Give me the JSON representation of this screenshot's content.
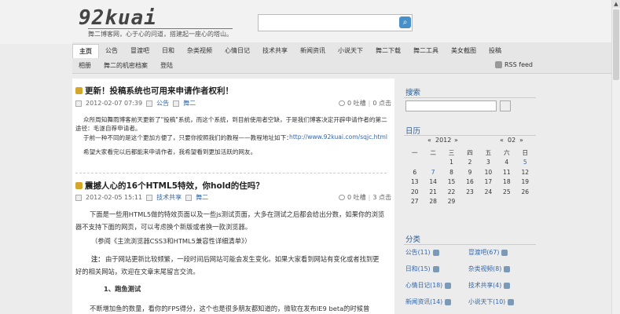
{
  "header": {
    "logo": "92kuai",
    "tagline": "舞二博客网，心于心的问道，搭建起一座心的塔山。",
    "search_placeholder": ""
  },
  "nav": {
    "row1": [
      "主页",
      "公告",
      "冒渡吧",
      "日和",
      "杂类视频",
      "心情日记",
      "技术共享",
      "新闻资讯",
      "小说天下",
      "舞二下载",
      "舞二工具",
      "美女截图",
      "投稿"
    ],
    "row2": [
      "相册",
      "舞二的机密档案",
      "登陆"
    ],
    "rss": "RSS feed"
  },
  "posts": [
    {
      "title": "更新！投稿系统也可用来申请作者权利！",
      "date": "2012-02-07 07:39",
      "category": "公告",
      "author": "舞二",
      "comments": "0 吐槽",
      "views": "0 点击",
      "lines": [
        "众所周知舞雨博客前天更新了\"投稿\"系统，而这个系统，到目前使用者空缺，于是我们博客决定开辟申请作者的第二",
        "途径：毛遂自荐申请者。",
        "于前一种不同的是这个更加方便了，只要你按照我们的教程——教程地址如下：",
        "http://www.92kuai.com/sqjc.html",
        "希望大家看完以后都能来申请作者，我希望看到更加活跃的网友。"
      ]
    },
    {
      "title": "震撼人心的16个HTML5特效，你hold的住吗？",
      "date": "2012-02-05 15:11",
      "category": "技术共享",
      "author": "舞二",
      "comments": "0 吐槽",
      "views": "3 点击",
      "lines": [
        "下面是一些用HTML5做的特效页面以及一些js测试页面，大多在测试之后都会给出分数，如果你的浏览",
        "器不支持下面的网页，可以考虑换个新版或者换一款浏览器。",
        "（参阅《主流浏览器CSS3和HTML5兼容性详细清单》）",
        "注：",
        "由于网站更新比较频繁，一段时间后网站可能会发生变化。如果大家看到网站有变化或者找到更",
        "好的相关网站，欢迎在文章末尾留言交流。",
        "1、跑鱼测试",
        "不断增加鱼的数量，看你的FPS得分，这个也是很多朋友都知道的，微软在发布IE9 beta的时候曾"
      ]
    }
  ],
  "sidebar": {
    "search_title": "搜索",
    "calendar_title": "日历",
    "calendar": {
      "year": "2012",
      "month": "02",
      "prev_year": "«",
      "next_year": "»",
      "prev_month": "«",
      "next_month": "»",
      "weekdays": [
        "一",
        "二",
        "三",
        "四",
        "五",
        "六",
        "日"
      ],
      "weeks": [
        [
          "",
          "",
          "1",
          "2",
          "3",
          "4",
          "5"
        ],
        [
          "6",
          "7",
          "8",
          "9",
          "10",
          "11",
          "12"
        ],
        [
          "13",
          "14",
          "15",
          "16",
          "17",
          "18",
          "19"
        ],
        [
          "20",
          "21",
          "22",
          "23",
          "24",
          "25",
          "26"
        ],
        [
          "27",
          "28",
          "29",
          "",
          "",
          "",
          ""
        ]
      ],
      "linked_days": [
        "5",
        "7"
      ]
    },
    "category_title": "分类",
    "categories": [
      "公告(11)",
      "冒渡吧(67)",
      "日和(15)",
      "杂类视频(8)",
      "心情日记(18)",
      "技术共享(4)",
      "新闻资讯(14)",
      "小说天下(10)"
    ]
  }
}
